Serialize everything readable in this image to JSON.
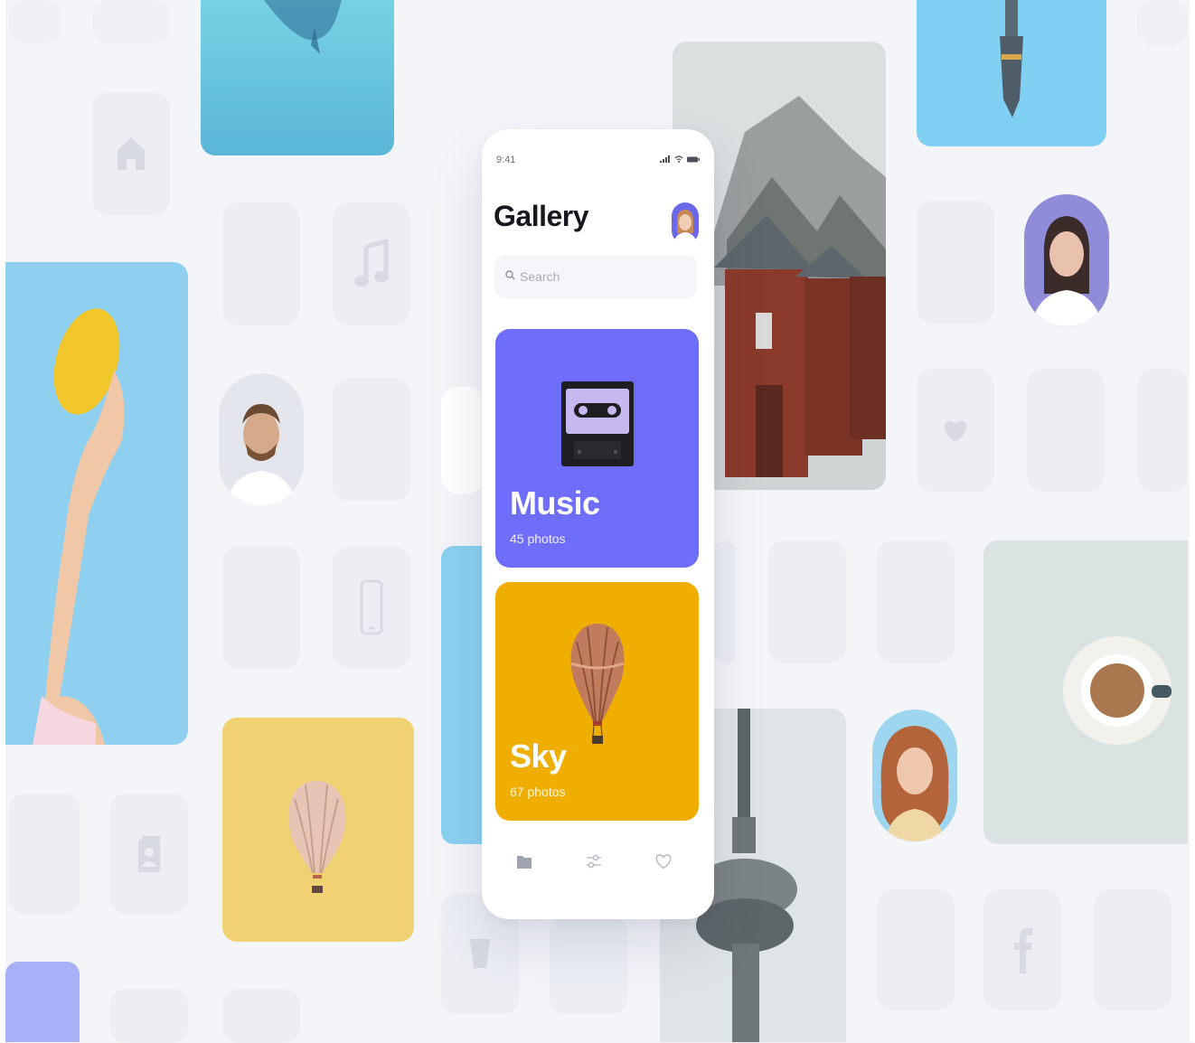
{
  "status_bar": {
    "time": "9:41"
  },
  "header": {
    "title": "Gallery"
  },
  "search": {
    "placeholder": "Search"
  },
  "albums": [
    {
      "title": "Music",
      "count": "45 photos",
      "color": "#6f6dfc"
    },
    {
      "title": "Sky",
      "count": "67 photos",
      "color": "#efae00"
    }
  ],
  "tabs": [
    {
      "icon": "folder-icon",
      "active": true
    },
    {
      "icon": "sliders-icon",
      "active": false
    },
    {
      "icon": "heart-icon",
      "active": false
    }
  ],
  "background_icons": [
    "home-icon",
    "music-note-icon",
    "phone-device-icon",
    "contact-card-icon",
    "cup-icon",
    "heart-icon",
    "facebook-icon"
  ],
  "colors": {
    "background": "#f4f5f9",
    "music_card": "#6f6dfc",
    "sky_card": "#efae00",
    "soft_yellow": "#f0d272",
    "sky_blue": "#8ad1f0",
    "lavender": "#aab0f8"
  }
}
